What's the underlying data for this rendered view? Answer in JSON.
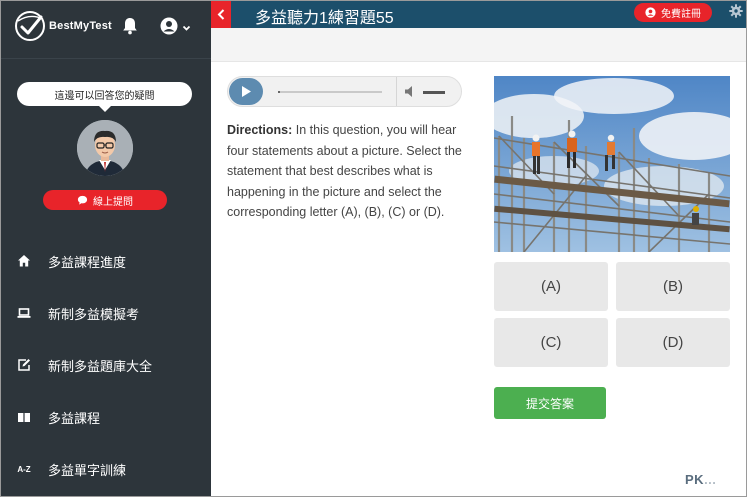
{
  "brand": {
    "name": "BestMyTest",
    "logo_icon": "brand-logo-icon"
  },
  "header_icons": {
    "notifications": "bell-icon",
    "account": "user-circle-icon"
  },
  "tip_bubble": "這邊可以回答您的疑問",
  "ask_button": {
    "label": "線上提問",
    "icon": "chat-bubble-icon"
  },
  "sidebar": {
    "items": [
      {
        "label": "多益課程進度",
        "icon": "home-icon"
      },
      {
        "label": "新制多益模擬考",
        "icon": "laptop-icon"
      },
      {
        "label": "新制多益題庫大全",
        "icon": "edit-icon"
      },
      {
        "label": "多益課程",
        "icon": "book-icon"
      },
      {
        "label": "多益單字訓練",
        "icon": "az-icon",
        "glyph": "A-Z"
      }
    ]
  },
  "topbar": {
    "title": "多益聽力1練習題55",
    "signup_label": "免費註冊",
    "back_icon": "chevron-left-icon",
    "settings_icon": "gear-icon"
  },
  "audio": {
    "progress": 0.02,
    "volume": 1.0
  },
  "directions": {
    "label": "Directions:",
    "text": " In this question, you will hear four statements about a picture. Select the statement that best describes what is happening in the picture and select the corresponding letter (A), (B), (C) or (D)."
  },
  "photo": {
    "subject": "workers on construction scaffolding"
  },
  "choices": [
    "(A)",
    "(B)",
    "(C)",
    "(D)"
  ],
  "submit_label": "提交答案",
  "watermark": {
    "left": "PK",
    "right": "...",
    "full": "PKSTEP"
  },
  "colors": {
    "sidebar_bg": "#2d353b",
    "topbar_bg": "#1c4f6b",
    "accent_red": "#e8242a",
    "submit_green": "#4caf50",
    "play_blue": "#5d8bb0"
  }
}
